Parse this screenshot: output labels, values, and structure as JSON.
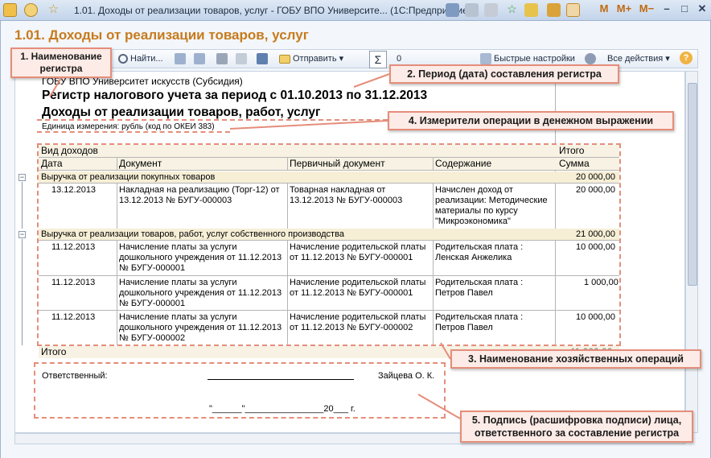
{
  "window": {
    "title": "1.01. Доходы от реализации товаров, услуг - ГОБУ ВПО Университе... (1С:Предприятие)",
    "buttons": [
      "M",
      "M+",
      "M−",
      "–",
      "□",
      "✕"
    ]
  },
  "document": {
    "title": "1.01. Доходы от реализации товаров, услуг"
  },
  "toolbar": {
    "find_label": "Найти...",
    "send_label": "Отправить",
    "sum_value": "0",
    "quick_settings_label": "Быстрые настройки",
    "all_actions_label": "Все действия",
    "help_label": "?"
  },
  "report": {
    "org": "ГОБУ ВПО Университет искусств (Субсидия)",
    "register_title": "Регистр налогового учета за период с 01.10.2013 по 31.12.2013",
    "income_title": "Доходы от реализации товаров, работ, услуг",
    "unit": "Единица измерения: рубль (код по ОКЕИ 383)",
    "header": {
      "income_type": "Вид доходов",
      "total": "Итого",
      "date": "Дата",
      "document": "Документ",
      "primary_doc": "Первичный документ",
      "content": "Содержание",
      "sum": "Сумма"
    },
    "groups": [
      {
        "name": "Выручка от реализации покупных товаров",
        "sum": "20 000,00",
        "rows": [
          {
            "date": "13.12.2013",
            "document": "Накладная на реализацию (Торг-12) от\n13.12.2013 № БУГУ-000003",
            "primary_doc": "Товарная накладная от\n13.12.2013 № БУГУ-000003",
            "content": "Начислен доход от\nреализации: Методические\nматериалы по курсу\n\"Микроэкономика\"",
            "sum": "20 000,00"
          }
        ]
      },
      {
        "name": "Выручка от реализации товаров, работ, услуг собственного производства",
        "sum": "21 000,00",
        "rows": [
          {
            "date": "11.12.2013",
            "document": "Начисление платы за услуги\nдошкольного учреждения от 11.12.2013\n№ БУГУ-000001",
            "primary_doc": "Начисление родительской платы\nот 11.12.2013 № БУГУ-000001",
            "content": "Родительская плата :\nЛенская Анжелика",
            "sum": "10 000,00"
          },
          {
            "date": "11.12.2013",
            "document": "Начисление платы за услуги\nдошкольного учреждения от 11.12.2013\n№ БУГУ-000001",
            "primary_doc": "Начисление родительской платы\nот 11.12.2013 № БУГУ-000001",
            "content": "Родительская плата :\nПетров Павел",
            "sum": "1 000,00"
          },
          {
            "date": "11.12.2013",
            "document": "Начисление платы за услуги\nдошкольного учреждения от 11.12.2013\n№ БУГУ-000002",
            "primary_doc": "Начисление родительской платы\nот 11.12.2013 № БУГУ-000002",
            "content": "Родительская плата :\nПетров Павел",
            "sum": "10 000,00"
          }
        ]
      }
    ],
    "total_label": "Итого",
    "total_sum": "41 000,00",
    "responsible_label": "Ответственный:",
    "responsible_name": "Зайцева О. К.",
    "date_line": "\"______\"________________20___ г."
  },
  "annotations": {
    "a1": "1. Наименование\nрегистра",
    "a2": "2. Период (дата) составления регистра",
    "a3": "3. Наименование хозяйственных операций",
    "a4": "4. Измерители операции в денежном выражении",
    "a5": "5. Подпись (расшифровка подписи) лица,\nответственного за составление регистра"
  }
}
